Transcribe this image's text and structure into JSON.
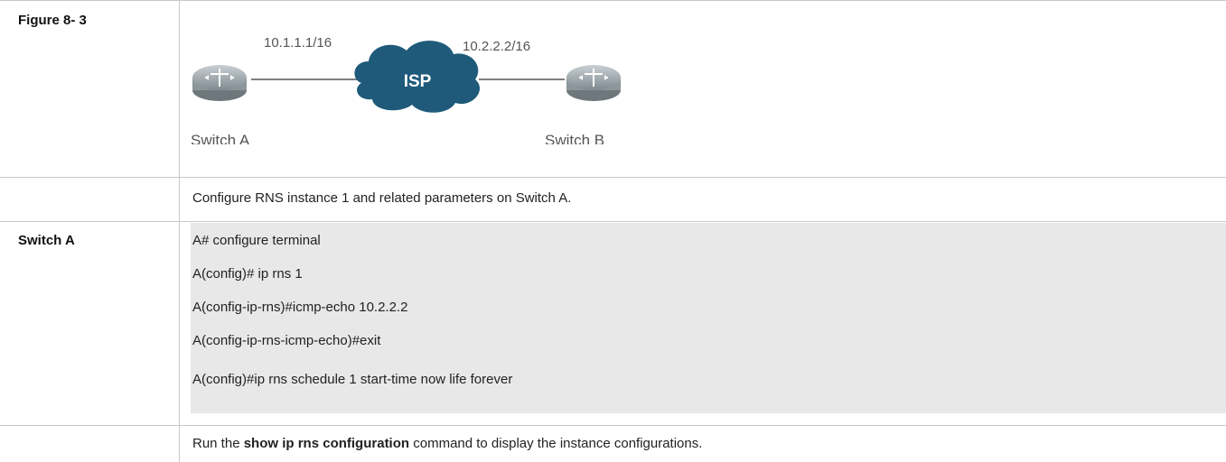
{
  "figure": {
    "label": "Figure 8- 3",
    "diagram": {
      "switch_a_ip": "10.1.1.1/16",
      "switch_b_ip": "10.2.2.2/16",
      "cloud_label": "ISP",
      "switch_a_name": "Switch A",
      "switch_b_name": "Switch B"
    }
  },
  "step1": {
    "label": "",
    "text": "Configure RNS instance 1 and related parameters on Switch A."
  },
  "switch_a": {
    "label": "Switch A",
    "lines": [
      "A# configure terminal",
      "A(config)# ip rns 1",
      "A(config-ip-rns)#icmp-echo 10.2.2.2",
      "A(config-ip-rns-icmp-echo)#exit",
      "A(config)#ip rns schedule 1 start-time now life forever"
    ]
  },
  "step2": {
    "text_before": "Run the ",
    "command": "show ip rns configuration",
    "text_after": " command to display the instance configurations."
  },
  "colors": {
    "code_background": "#e8e8e8",
    "cloud": "#1f5a7a",
    "switch_body": "#9aa3a8"
  }
}
